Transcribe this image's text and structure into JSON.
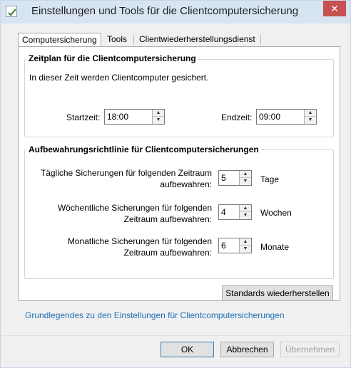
{
  "window": {
    "title": "Einstellungen und Tools für die Clientcomputersicherung",
    "close_glyph": "✕"
  },
  "tabs": [
    {
      "label": "Computersicherung",
      "active": true
    },
    {
      "label": "Tools",
      "active": false
    },
    {
      "label": "Clientwiederherstellungsdienst",
      "active": false
    }
  ],
  "schedule": {
    "title": "Zeitplan für die Clientcomputersicherung",
    "description": "In dieser Zeit werden Clientcomputer gesichert.",
    "start_label": "Startzeit:",
    "start_value": "18:00",
    "end_label": "Endzeit:",
    "end_value": "09:00"
  },
  "retention": {
    "title": "Aufbewahrungsrichtlinie für Clientcomputersicherungen",
    "daily": {
      "label_line1": "Tägliche Sicherungen für folgenden Zeitraum",
      "label_line2": "aufbewahren:",
      "value": "5",
      "unit": "Tage"
    },
    "weekly": {
      "label_line1": "Wöchentliche Sicherungen für folgenden",
      "label_line2": "Zeitraum aufbewahren:",
      "value": "4",
      "unit": "Wochen"
    },
    "monthly": {
      "label_line1": "Monatliche Sicherungen für folgenden",
      "label_line2": "Zeitraum aufbewahren:",
      "value": "6",
      "unit": "Monate"
    }
  },
  "restore_defaults_label": "Standards wiederherstellen",
  "help_link": "Grundlegendes zu den Einstellungen für Clientcomputersicherungen",
  "footer": {
    "ok": "OK",
    "cancel": "Abbrechen",
    "apply": "Übernehmen"
  },
  "spin_up_glyph": "▲",
  "spin_down_glyph": "▼"
}
